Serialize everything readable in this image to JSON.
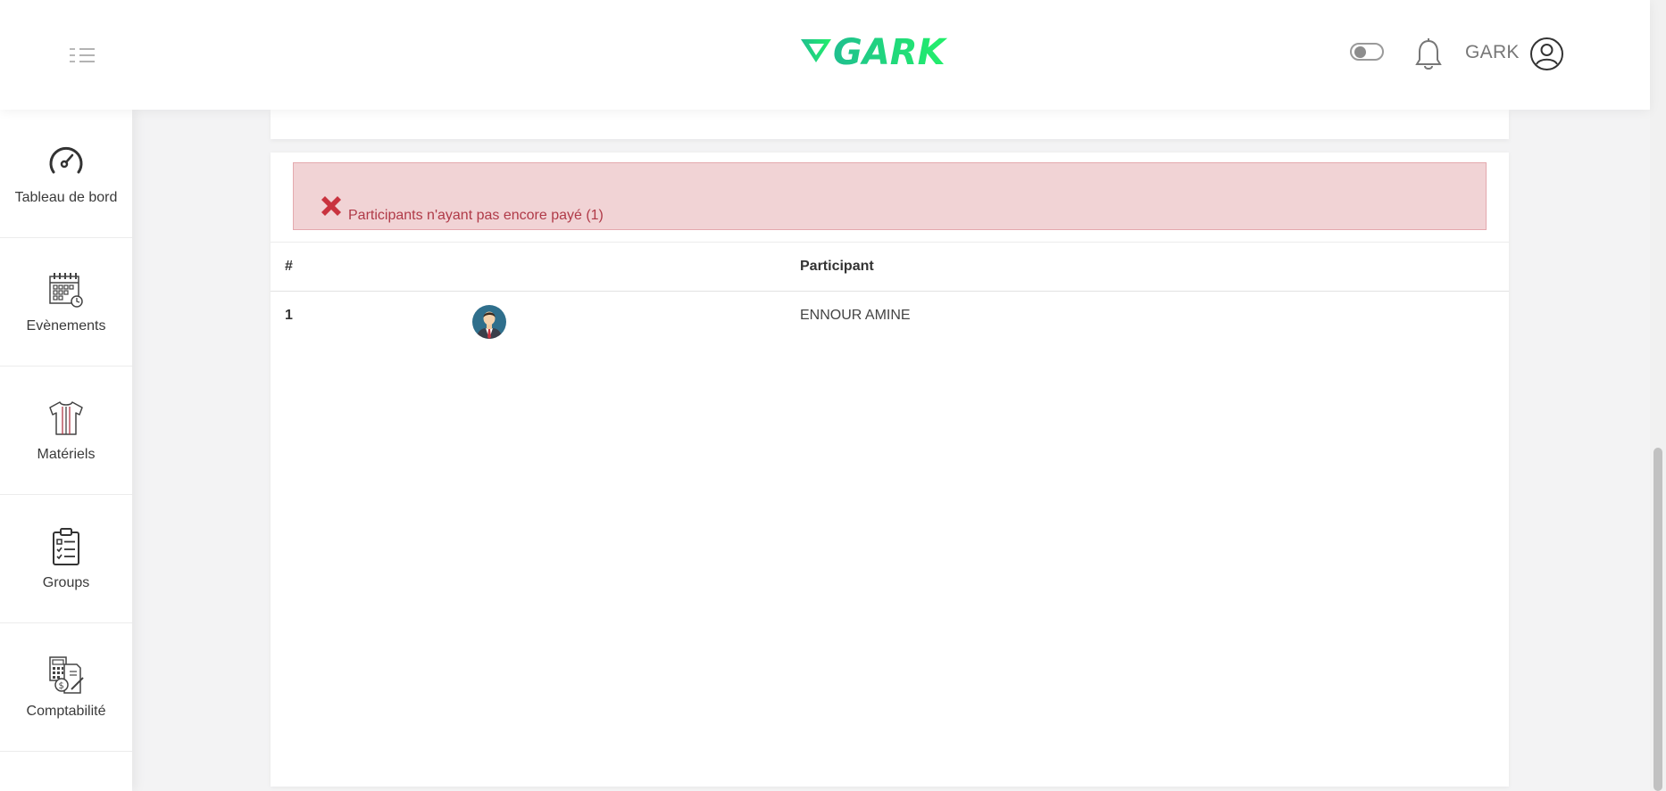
{
  "header": {
    "logo_text": "GARK",
    "username": "GARK",
    "icons": [
      "menu-icon",
      "theme-toggle",
      "bell-icon",
      "user-circle-icon"
    ]
  },
  "sidebar": {
    "items": [
      {
        "label": "Tableau de bord",
        "icon": "speedometer-icon"
      },
      {
        "label": "Evènements",
        "icon": "calendar-icon"
      },
      {
        "label": "Matériels",
        "icon": "jersey-icon"
      },
      {
        "label": "Groups",
        "icon": "clipboard-checklist-icon"
      },
      {
        "label": "Comptabilité",
        "icon": "accounting-icon"
      }
    ]
  },
  "alert": {
    "message": "Participants n'ayant pas encore payé (1)",
    "icon": "close-x-icon",
    "color": "#b03a48"
  },
  "table": {
    "headers": {
      "num": "#",
      "participant": "Participant"
    },
    "rows": [
      {
        "num": "1",
        "avatar": "avatar-icon",
        "name": "ENNOUR AMINE"
      }
    ]
  },
  "colors": {
    "brand_green": "#19e07a",
    "alert_bg": "#f1d3d5",
    "alert_border": "#e4a9ae"
  }
}
